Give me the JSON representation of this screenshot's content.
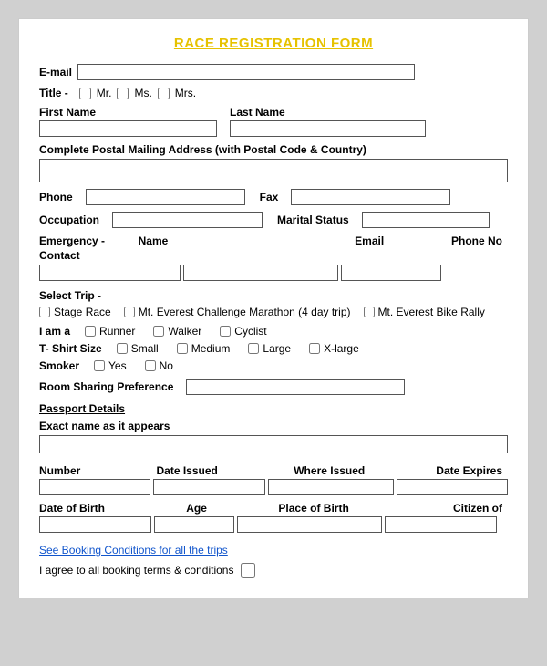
{
  "title": "RACE REGISTRATION FORM",
  "fields": {
    "email_label": "E-mail",
    "title_label": "Title -",
    "mr_label": "Mr.",
    "ms_label": "Ms.",
    "mrs_label": "Mrs.",
    "first_name_label": "First Name",
    "last_name_label": "Last Name",
    "postal_label": "Complete Postal Mailing Address (with Postal Code & Country)",
    "phone_label": "Phone",
    "fax_label": "Fax",
    "occupation_label": "Occupation",
    "marital_label": "Marital Status",
    "emergency_label": "Emergency -\nContact",
    "name_label": "Name",
    "email_col_label": "Email",
    "phone_no_label": "Phone No",
    "select_trip_label": "Select Trip -",
    "stage_race_label": "Stage Race",
    "mt_everest_label": "Mt. Everest Challenge Marathon (4 day trip)",
    "mt_bike_label": "Mt. Everest Bike Rally",
    "iam_a_label": "I am a",
    "runner_label": "Runner",
    "walker_label": "Walker",
    "cyclist_label": "Cyclist",
    "tshirt_label": "T- Shirt Size",
    "small_label": "Small",
    "medium_label": "Medium",
    "large_label": "Large",
    "xlarge_label": "X-large",
    "smoker_label": "Smoker",
    "yes_label": "Yes",
    "no_label": "No",
    "room_sharing_label": "Room Sharing Preference",
    "passport_details_label": "Passport Details",
    "exact_name_label": "Exact name as it appears",
    "number_label": "Number",
    "date_issued_label": "Date Issued",
    "where_issued_label": "Where Issued",
    "date_expires_label": "Date Expires",
    "dob_label": "Date of Birth",
    "age_label": "Age",
    "place_of_birth_label": "Place of Birth",
    "citizen_of_label": "Citizen of",
    "booking_link_label": "See Booking Conditions for all the trips",
    "agree_label": "I agree to all booking terms & conditions"
  }
}
